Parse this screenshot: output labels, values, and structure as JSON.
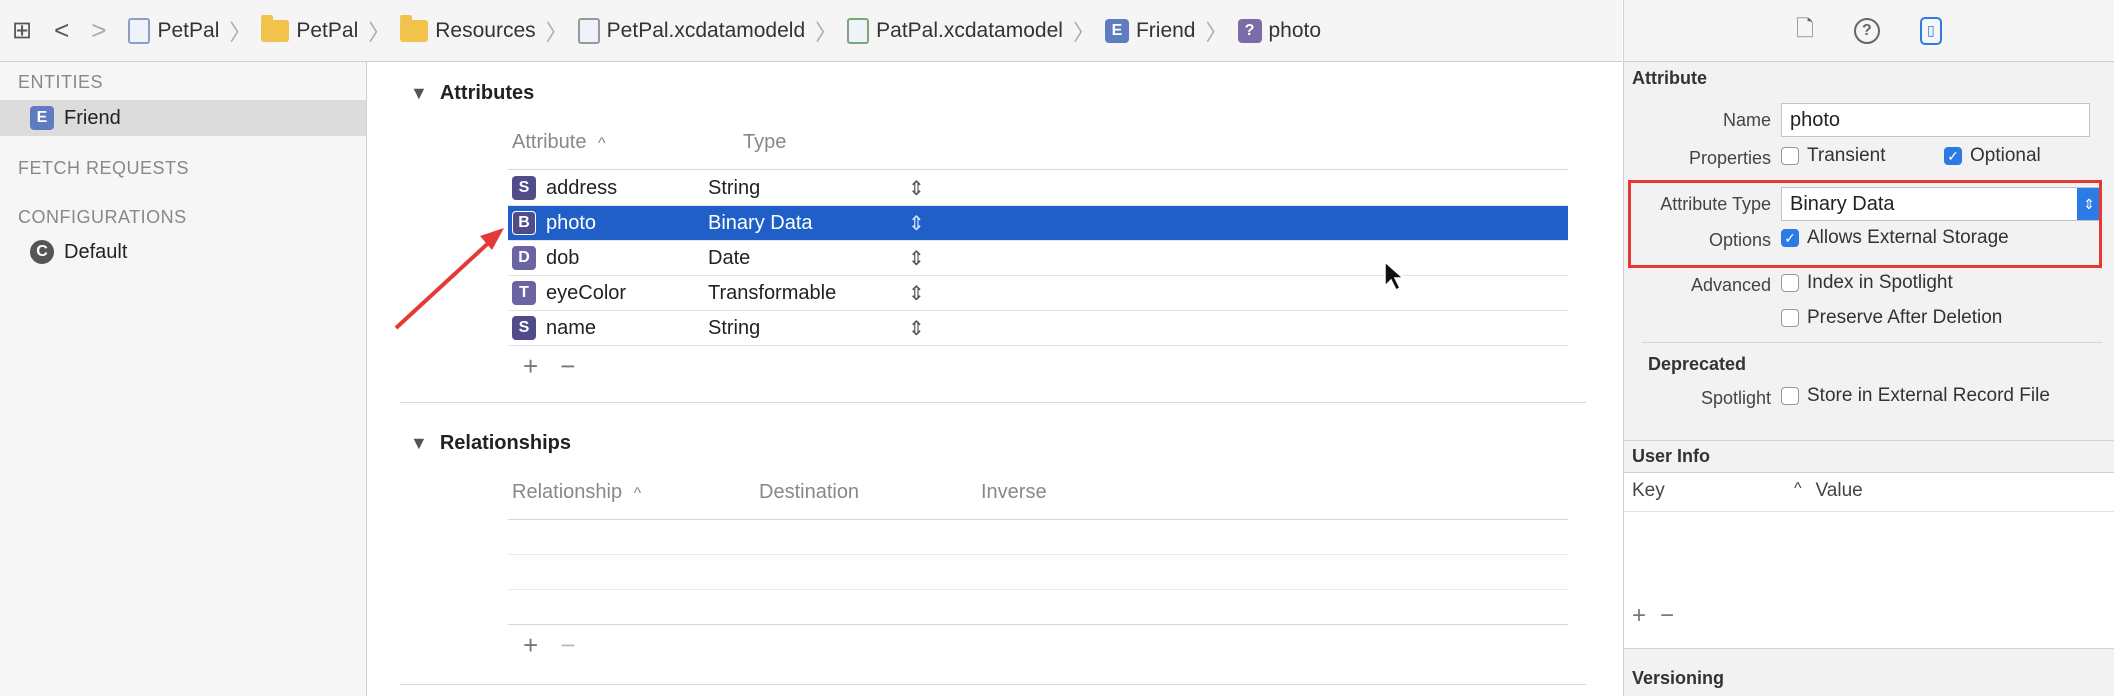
{
  "breadcrumbs": [
    {
      "label": "PetPal",
      "icon": "project-file-icon"
    },
    {
      "label": "PetPal",
      "icon": "folder-icon"
    },
    {
      "label": "Resources",
      "icon": "folder-icon"
    },
    {
      "label": "PetPal.xcdatamodeld",
      "icon": "datamodel-bundle-icon"
    },
    {
      "label": "PatPal.xcdatamodel",
      "icon": "datamodel-file-icon"
    },
    {
      "label": "Friend",
      "icon": "entity-icon",
      "tag": "E"
    },
    {
      "label": "photo",
      "icon": "attribute-icon",
      "tag": "?"
    }
  ],
  "outline": {
    "entities_header": "ENTITIES",
    "entity": "Friend",
    "entity_tag": "E",
    "fetch_header": "FETCH REQUESTS",
    "config_header": "CONFIGURATIONS",
    "config": "Default",
    "config_tag": "C"
  },
  "attributes": {
    "title": "Attributes",
    "col_attribute": "Attribute",
    "col_type": "Type",
    "rows": [
      {
        "tag": "S",
        "name": "address",
        "type": "String"
      },
      {
        "tag": "B",
        "name": "photo",
        "type": "Binary Data"
      },
      {
        "tag": "D",
        "name": "dob",
        "type": "Date"
      },
      {
        "tag": "T",
        "name": "eyeColor",
        "type": "Transformable"
      },
      {
        "tag": "S",
        "name": "name",
        "type": "String"
      }
    ]
  },
  "relationships": {
    "title": "Relationships",
    "col_relationship": "Relationship",
    "col_destination": "Destination",
    "col_inverse": "Inverse"
  },
  "controls": {
    "plus": "+",
    "minus": "−",
    "caret_up": "^",
    "disclosure": "▼",
    "updown": "⇕"
  },
  "inspector": {
    "section": "Attribute",
    "name_label": "Name",
    "name_value": "photo",
    "properties_label": "Properties",
    "transient": "Transient",
    "optional": "Optional",
    "attr_type_label": "Attribute Type",
    "attr_type_value": "Binary Data",
    "options_label": "Options",
    "allows_external": "Allows External Storage",
    "advanced_label": "Advanced",
    "index_spotlight": "Index in Spotlight",
    "preserve": "Preserve After Deletion",
    "deprecated": "Deprecated",
    "spotlight_label": "Spotlight",
    "store_external": "Store in External Record File",
    "user_info": "User Info",
    "key": "Key",
    "value": "Value",
    "versioning": "Versioning"
  },
  "colors": {
    "selection": "#1f5fc7",
    "highlight": "#e53935",
    "accent": "#2c7be5"
  }
}
